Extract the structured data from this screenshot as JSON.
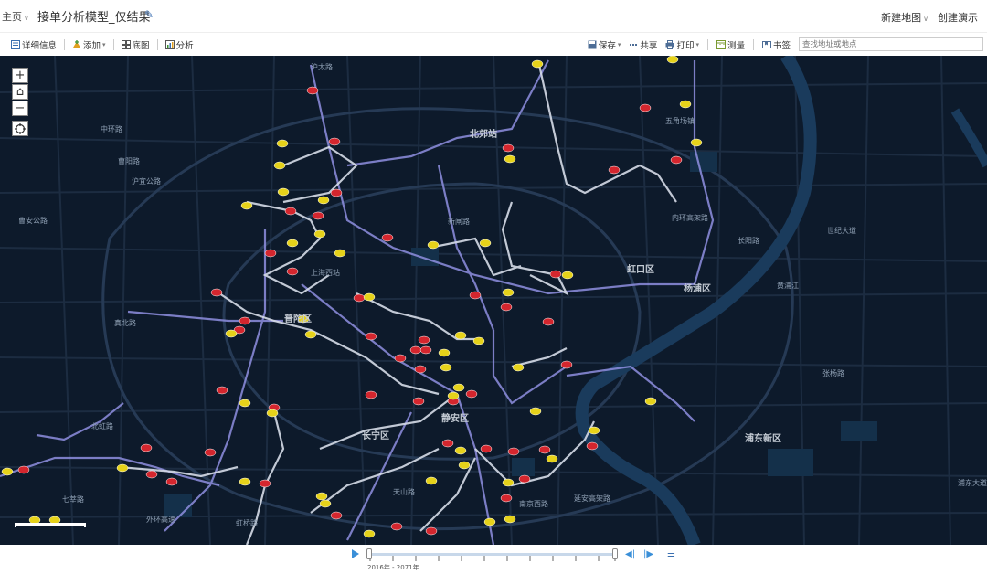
{
  "header": {
    "home": "主页",
    "title": "接单分析模型_仅结果",
    "new_map": "新建地图",
    "create_demo": "创建演示"
  },
  "toolbar": {
    "details": "详细信息",
    "add": "添加",
    "basemap": "底图",
    "analysis": "分析",
    "save": "保存",
    "share": "共享",
    "print": "打印",
    "measure": "测量",
    "bookmarks": "书签",
    "search_placeholder": "查找地址或地点"
  },
  "map": {
    "districts": [
      "北郊站",
      "虹口区",
      "杨浦区",
      "长宁区",
      "静安区",
      "浦东新区",
      "普陀区",
      "上海西站",
      "五角场镇"
    ],
    "streets": [
      "沪太路",
      "中环路",
      "曹阳路",
      "沪宜公路",
      "真北路",
      "曹安公路",
      "北虹路",
      "天山路",
      "外环高速",
      "七莘路",
      "新闸路",
      "虹桥路",
      "南京西路",
      "延安高架路",
      "内环高架路",
      "长阳路",
      "黄浦江",
      "张杨路",
      "世纪大道",
      "浦东大道"
    ],
    "zoom_in": "+",
    "zoom_out": "−",
    "home_btn": "⌂"
  },
  "timeslider": {
    "range": "2016年 - 2071年"
  },
  "colors": {
    "map_bg": "#0d1a2b",
    "road": "#1d2e44",
    "route_purple": "#8f8fe0",
    "route_white": "#d6dce8",
    "car_red": "#d4262e",
    "car_yellow": "#e6d21a",
    "river": "#1a3b5c",
    "accent_blue": "#3a8fd8"
  }
}
